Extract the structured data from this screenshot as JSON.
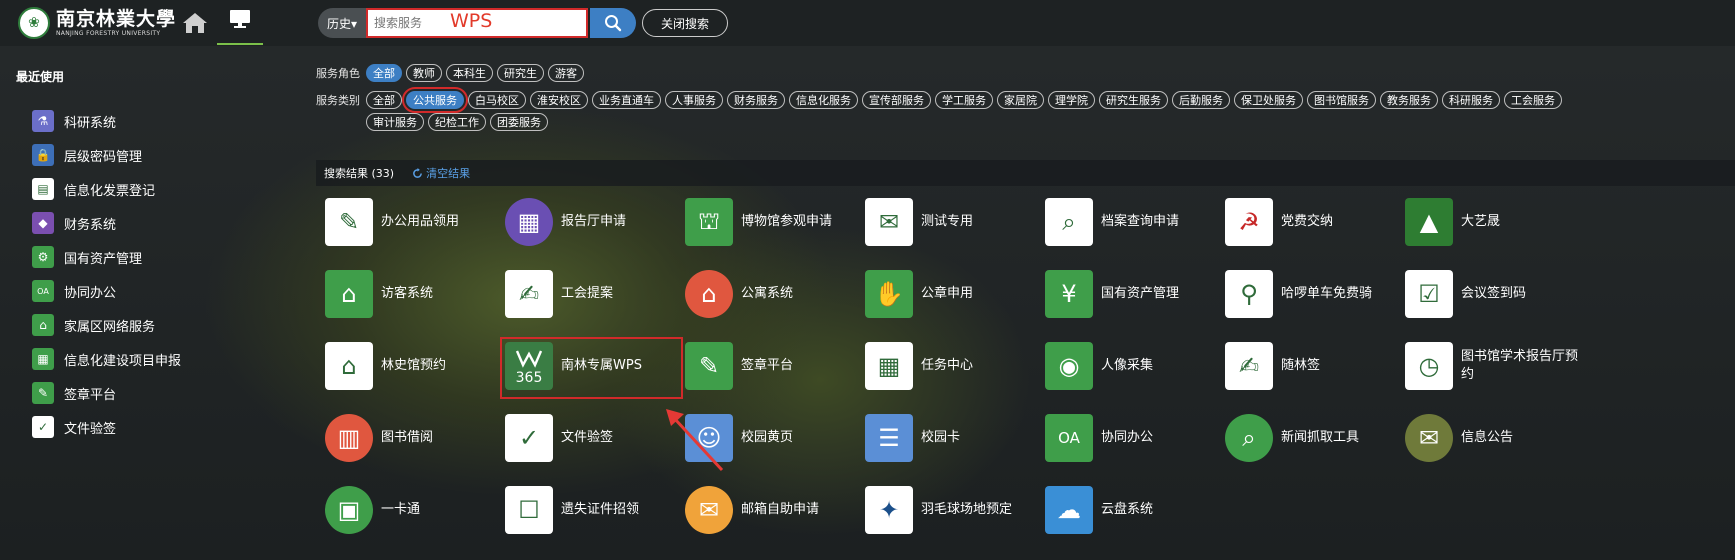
{
  "header": {
    "logo_cn": "南京林業大學",
    "logo_en": "NANJING FORESTRY UNIVERSITY",
    "history_label": "历史▾",
    "search_placeholder": "搜索服务",
    "search_value": "WPS",
    "close_search_label": "关闭搜索"
  },
  "sidebar": {
    "title": "最近使用",
    "items": [
      {
        "label": "科研系统",
        "icon": "scientist-icon",
        "color": "#6b6fc9"
      },
      {
        "label": "层级密码管理",
        "icon": "lock-icon",
        "color": "#3d6fb8"
      },
      {
        "label": "信息化发票登记",
        "icon": "invoice-icon",
        "color": "#ffffff"
      },
      {
        "label": "财务系统",
        "icon": "shield-icon",
        "color": "#7b4fb0"
      },
      {
        "label": "国有资产管理",
        "icon": "gear-icon",
        "color": "#3f9e4a"
      },
      {
        "label": "协同办公",
        "icon": "oa-icon",
        "color": "#3f9e4a"
      },
      {
        "label": "家属区网络服务",
        "icon": "family-icon",
        "color": "#3f9e4a"
      },
      {
        "label": "信息化建设项目申报",
        "icon": "report-icon",
        "color": "#3f9e4a"
      },
      {
        "label": "签章平台",
        "icon": "sign-icon",
        "color": "#3f9e4a"
      },
      {
        "label": "文件验签",
        "icon": "file-verify-icon",
        "color": "#ffffff"
      }
    ]
  },
  "filters": {
    "role_label": "服务角色",
    "roles": [
      "全部",
      "教师",
      "本科生",
      "研究生",
      "游客"
    ],
    "category_label": "服务类别",
    "categories_row1": [
      "全部",
      "公共服务",
      "白马校区",
      "淮安校区",
      "业务直通车",
      "人事服务",
      "财务服务",
      "信息化服务",
      "宣传部服务",
      "学工服务",
      "家居院",
      "理学院",
      "研究生服务",
      "后勤服务",
      "保卫处服务",
      "图书馆服务",
      "教务服务",
      "科研服务",
      "工会服务"
    ],
    "categories_row2": [
      "审计服务",
      "纪检工作",
      "团委服务"
    ]
  },
  "results": {
    "title": "搜索结果 (33)",
    "clear_label": "清空结果"
  },
  "apps": [
    {
      "label": "办公用品领用",
      "icon": "office-supplies-icon",
      "bg": "#ffffff",
      "fg": "#2f6b3a"
    },
    {
      "label": "报告厅申请",
      "icon": "building-icon",
      "bg": "#6a4fb3",
      "fg": "#ffffff",
      "round": true
    },
    {
      "label": "博物馆参观申请",
      "icon": "museum-icon",
      "bg": "#3f9e4a",
      "fg": "#ffffff"
    },
    {
      "label": "测试专用",
      "icon": "scroll-icon",
      "bg": "#ffffff",
      "fg": "#2f6b3a"
    },
    {
      "label": "档案查询申请",
      "icon": "archive-search-icon",
      "bg": "#ffffff",
      "fg": "#2f6b3a"
    },
    {
      "label": "党费交纳",
      "icon": "party-fee-icon",
      "bg": "#ffffff",
      "fg": "#c62828"
    },
    {
      "label": "大艺晟",
      "icon": "art-icon",
      "bg": "#2e7d32",
      "fg": "#ffffff"
    },
    {
      "label": "访客系统",
      "icon": "door-icon",
      "bg": "#3f9e4a",
      "fg": "#ffffff"
    },
    {
      "label": "工会提案",
      "icon": "proposal-icon",
      "bg": "#ffffff",
      "fg": "#2f6b3a"
    },
    {
      "label": "公寓系统",
      "icon": "apartment-icon",
      "bg": "#e0573f",
      "fg": "#ffffff",
      "round": true
    },
    {
      "label": "公章申用",
      "icon": "stamp-icon",
      "bg": "#3f9e4a",
      "fg": "#ffffff"
    },
    {
      "label": "国有资产管理",
      "icon": "gear-yen-icon",
      "bg": "#3f9e4a",
      "fg": "#ffffff"
    },
    {
      "label": "哈啰单车免费骑",
      "icon": "bike-icon",
      "bg": "#ffffff",
      "fg": "#2f6b3a"
    },
    {
      "label": "会议签到码",
      "icon": "clipboard-icon",
      "bg": "#ffffff",
      "fg": "#2f6b3a"
    },
    {
      "label": "林史馆预约",
      "icon": "house-clock-icon",
      "bg": "#ffffff",
      "fg": "#2f6b3a"
    },
    {
      "label": "南林专属WPS",
      "icon": "wps-365-icon",
      "bg": "#3a7d44",
      "fg": "#ffffff"
    },
    {
      "label": "签章平台",
      "icon": "sign-platform-icon",
      "bg": "#3f9e4a",
      "fg": "#ffffff"
    },
    {
      "label": "任务中心",
      "icon": "calendar-grid-icon",
      "bg": "#ffffff",
      "fg": "#2f6b3a"
    },
    {
      "label": "人像采集",
      "icon": "camera-icon",
      "bg": "#3f9e4a",
      "fg": "#ffffff"
    },
    {
      "label": "随林签",
      "icon": "sign-doc-icon",
      "bg": "#ffffff",
      "fg": "#2f6b3a"
    },
    {
      "label": "图书馆学术报告厅预约",
      "icon": "lectern-clock-icon",
      "bg": "#ffffff",
      "fg": "#2f6b3a"
    },
    {
      "label": "图书借阅",
      "icon": "book-icon",
      "bg": "#e0573f",
      "fg": "#ffffff",
      "round": true
    },
    {
      "label": "文件验签",
      "icon": "file-verify-icon",
      "bg": "#ffffff",
      "fg": "#2f6b3a"
    },
    {
      "label": "校园黄页",
      "icon": "contact-book-icon",
      "bg": "#5b8fd6",
      "fg": "#ffffff"
    },
    {
      "label": "校园卡",
      "icon": "id-card-icon",
      "bg": "#5b8fd6",
      "fg": "#ffffff"
    },
    {
      "label": "协同办公",
      "icon": "oa-icon",
      "bg": "#3f9e4a",
      "fg": "#ffffff"
    },
    {
      "label": "新闻抓取工具",
      "icon": "news-icon",
      "bg": "#3f9e4a",
      "fg": "#ffffff",
      "round": true
    },
    {
      "label": "信息公告",
      "icon": "notice-icon",
      "bg": "#6f7a3a",
      "fg": "#ffffff",
      "round": true
    },
    {
      "label": "一卡通",
      "icon": "card-badge-icon",
      "bg": "#3f9e4a",
      "fg": "#ffffff",
      "round": true
    },
    {
      "label": "遗失证件招领",
      "icon": "lost-card-icon",
      "bg": "#ffffff",
      "fg": "#2f6b3a"
    },
    {
      "label": "邮箱自助申请",
      "icon": "mail-icon",
      "bg": "#f0a33a",
      "fg": "#ffffff",
      "round": true
    },
    {
      "label": "羽毛球场地预定",
      "icon": "badminton-icon",
      "bg": "#ffffff",
      "fg": "#1b4f8a"
    },
    {
      "label": "云盘系统",
      "icon": "cloud-icon",
      "bg": "#3a8fd6",
      "fg": "#ffffff"
    }
  ],
  "colors": {
    "accent": "#3d7fc4",
    "highlight": "#d12a2a",
    "brand_green": "#3f9e4a"
  }
}
